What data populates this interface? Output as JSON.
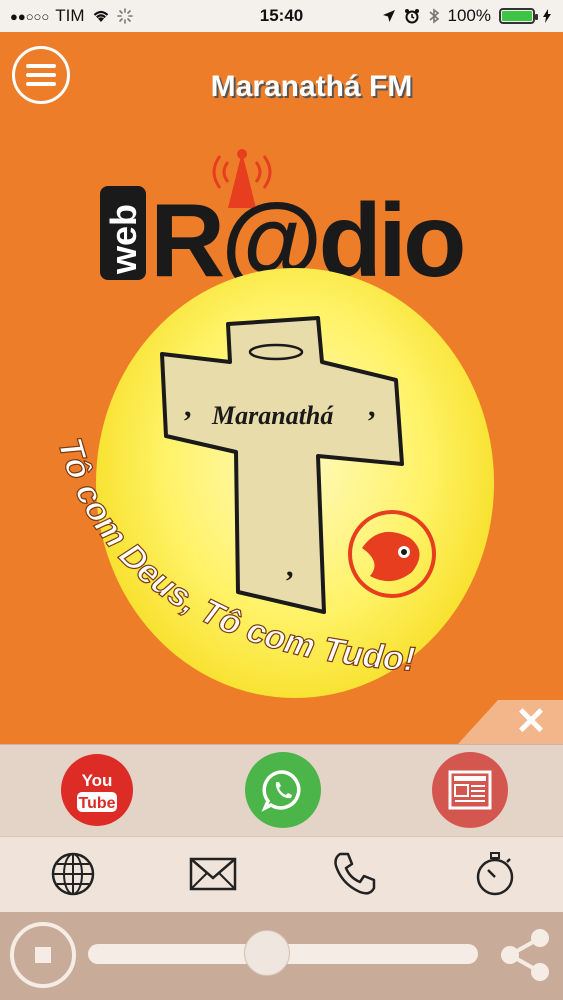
{
  "status_bar": {
    "signal_dots": "●●○○○",
    "carrier": "TIM",
    "time": "15:40",
    "battery_percent": "100%",
    "battery_level": 1.0
  },
  "header": {
    "station_name": "Maranathá FM"
  },
  "logo": {
    "web_text": "web",
    "radio_text": "R@dio",
    "cross_text": "Maranathá",
    "slogan": "Tô com Deus, Tô com Tudo!"
  },
  "colors": {
    "brand_orange": "#ee7d2a",
    "youtube_red": "#dd2b25",
    "whatsapp_green": "#4cb549",
    "news_red": "#d4574f"
  },
  "social": {
    "youtube_top": "You",
    "youtube_bottom": "Tube"
  },
  "player": {
    "volume_level": 0.46
  }
}
